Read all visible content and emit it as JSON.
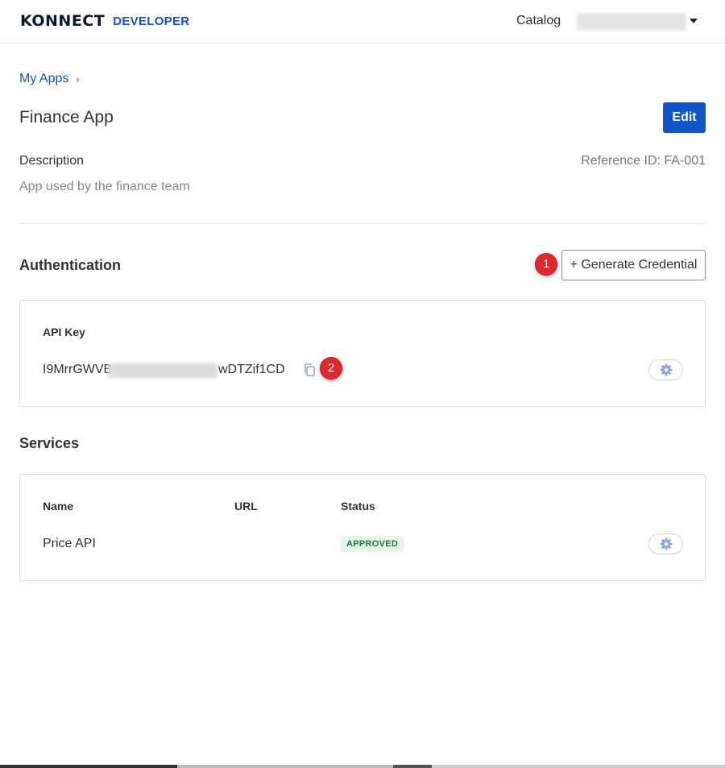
{
  "header": {
    "logo_main": "KONNECT",
    "logo_sub": "DEVELOPER",
    "catalog_label": "Catalog"
  },
  "breadcrumb": {
    "root": "My Apps",
    "separator": "›"
  },
  "app": {
    "title": "Finance App",
    "edit_label": "Edit",
    "description_label": "Description",
    "description": "App used by the finance team",
    "reference_id": "Reference ID: FA-001"
  },
  "authentication": {
    "title": "Authentication",
    "generate_label": "+ Generate Credential",
    "api_key_label": "API Key",
    "api_key_prefix": "I9MrrGWVB",
    "api_key_suffix": "wDTZif1CD"
  },
  "markers": [
    "1",
    "2"
  ],
  "services": {
    "title": "Services",
    "columns": [
      "Name",
      "URL",
      "Status"
    ],
    "rows": [
      {
        "name": "Price API",
        "url": "",
        "status": "APPROVED"
      }
    ]
  },
  "colors": {
    "brand": "#1155cb",
    "marker": "#e3262b",
    "approved_bg": "#e7f6ec",
    "approved_text": "#13803a"
  },
  "icons": [
    "copy-icon",
    "gear-icon",
    "chevron-down-icon"
  ]
}
